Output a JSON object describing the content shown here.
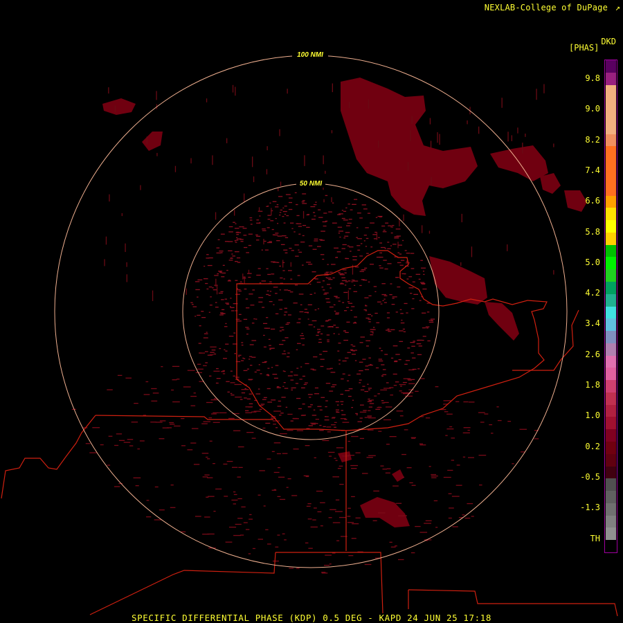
{
  "header": {
    "credit": "NEXLAB-College of DuPage",
    "credit_icon": "external-link-icon",
    "product_code": "DKD",
    "unit": "[PHAS]"
  },
  "rings": {
    "outer_label": "100 NMI",
    "inner_label": "50 NMI"
  },
  "legend": {
    "ticks": [
      "9.8",
      "9.0",
      "8.2",
      "7.4",
      "6.6",
      "5.8",
      "5.0",
      "4.2",
      "3.4",
      "2.6",
      "1.8",
      "1.0",
      "0.2",
      "-0.5",
      "-1.3",
      "TH"
    ],
    "colors": [
      "#5a0060",
      "#9a2080",
      "#f2b080",
      "#f2b080",
      "#f2b080",
      "#f2b080",
      "#f09060",
      "#ff7020",
      "#ff7020",
      "#ff7020",
      "#ff7020",
      "#ffa000",
      "#ffe000",
      "#ffff00",
      "#ffd000",
      "#00c000",
      "#00f000",
      "#20d020",
      "#00a060",
      "#20b090",
      "#40e0e0",
      "#60c0e0",
      "#8090c0",
      "#b080b0",
      "#e070b0",
      "#e060a0",
      "#d04070",
      "#c03050",
      "#b02040",
      "#a01030",
      "#800020",
      "#700010",
      "#600010",
      "#400010",
      "#505050",
      "#606060",
      "#707070",
      "#808080",
      "#909090",
      "#000000"
    ],
    "accent_border": "#a000a0"
  },
  "caption": "SPECIFIC DIFFERENTIAL PHASE (KDP) 0.5 DEG - KAPD 24 JUN 25 17:18",
  "map": {
    "ring_color": "#f0b090",
    "boundary_color": "#d02010",
    "echo_color": "#700010"
  }
}
